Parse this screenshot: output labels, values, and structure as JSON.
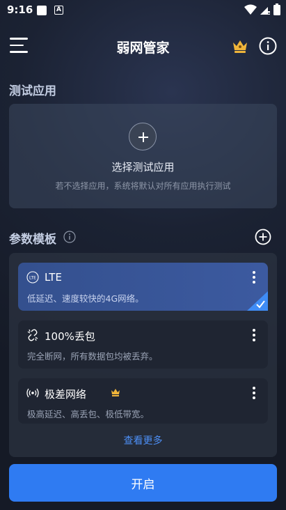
{
  "status_bar": {
    "time": "9:16",
    "notif_a_glyph": "A"
  },
  "app_bar": {
    "title": "弱网管家",
    "menu_icon": "menu-icon",
    "crown_icon": "crown-icon",
    "info_icon": "info-icon"
  },
  "test_app": {
    "section_title": "测试应用",
    "card_title": "选择测试应用",
    "card_desc": "若不选择应用，系统将默认对所有应用执行测试"
  },
  "templates": {
    "section_title": "参数模板",
    "items": [
      {
        "name": "LTE",
        "desc": "低延迟、速度较快的4G网络。",
        "selected": true,
        "icon": "lte-icon"
      },
      {
        "name": "100%丢包",
        "desc": "完全断网，所有数据包均被丢弃。",
        "selected": false,
        "icon": "broken-link-icon"
      },
      {
        "name": "极差网络",
        "desc": "极高延迟、高丢包、极低带宽。",
        "selected": false,
        "icon": "broadcast-icon",
        "premium": true
      }
    ],
    "see_more": "查看更多"
  },
  "start_button": "开启",
  "colors": {
    "accent": "#2f7bf2",
    "selected_card": "#3c5aa0",
    "crown": "#f0b53a",
    "link": "#4d8ff5"
  }
}
